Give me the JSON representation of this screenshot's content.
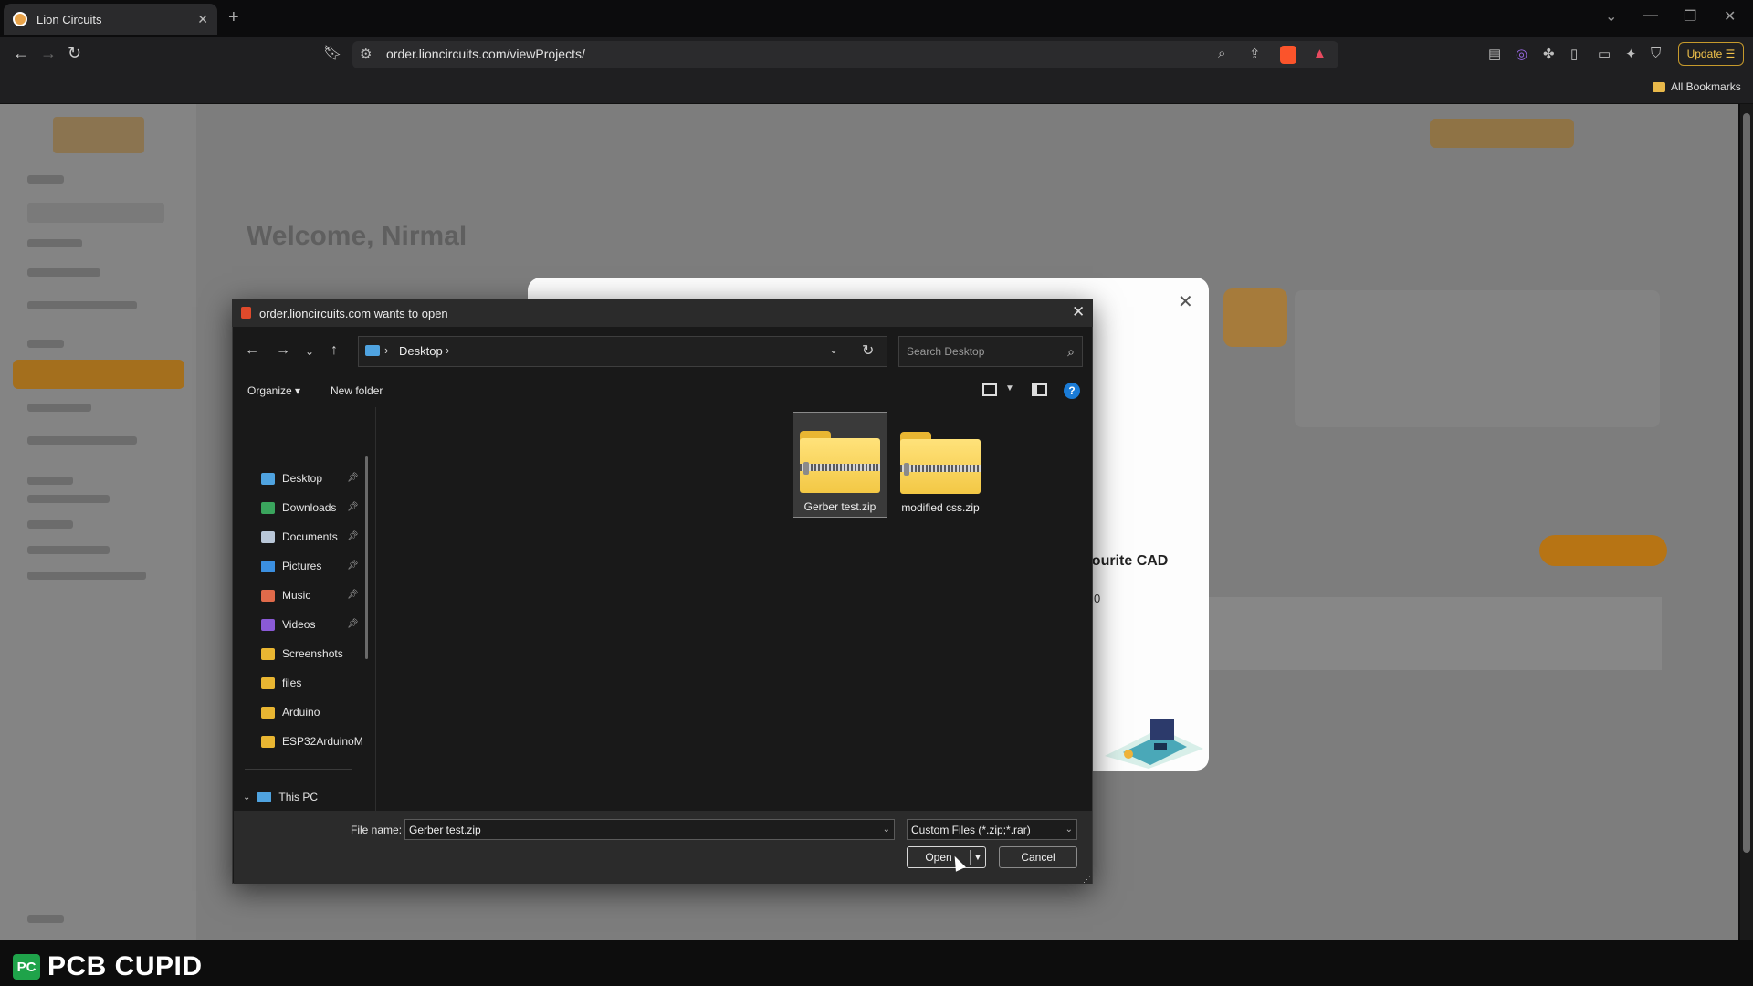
{
  "browser": {
    "tab_title": "Lion Circuits",
    "url": "order.lioncircuits.com/viewProjects/",
    "update_label": "Update",
    "bookmarks_label": "All Bookmarks"
  },
  "page": {
    "welcome": "Welcome, Nirmal",
    "modal_partial_text": "avourite CAD",
    "modal_partial_text2": "0"
  },
  "dialog": {
    "title": "order.lioncircuits.com wants to open",
    "address": {
      "segment": "Desktop"
    },
    "search_placeholder": "Search Desktop",
    "organize_label": "Organize",
    "new_folder_label": "New folder",
    "nav_items": [
      {
        "label": "Desktop",
        "icon": "desktop-icon",
        "pinned": true,
        "color": "#4fa3e0"
      },
      {
        "label": "Downloads",
        "icon": "download-icon",
        "pinned": true,
        "color": "#3aa55d"
      },
      {
        "label": "Documents",
        "icon": "document-icon",
        "pinned": true,
        "color": "#b9c7d8"
      },
      {
        "label": "Pictures",
        "icon": "pictures-icon",
        "pinned": true,
        "color": "#3b8fe0"
      },
      {
        "label": "Music",
        "icon": "music-icon",
        "pinned": true,
        "color": "#e06a4a"
      },
      {
        "label": "Videos",
        "icon": "videos-icon",
        "pinned": true,
        "color": "#8a5ad6"
      },
      {
        "label": "Screenshots",
        "icon": "folder-icon",
        "pinned": false,
        "color": "#e9b632"
      },
      {
        "label": "files",
        "icon": "folder-icon",
        "pinned": false,
        "color": "#e9b632"
      },
      {
        "label": "Arduino",
        "icon": "folder-icon",
        "pinned": false,
        "color": "#e9b632"
      },
      {
        "label": "ESP32ArduinoM",
        "icon": "folder-icon",
        "pinned": false,
        "color": "#e9b632"
      }
    ],
    "this_pc_label": "This PC",
    "files": [
      {
        "name": "Gerber test.zip",
        "selected": true,
        "icon": "zip-folder-icon"
      },
      {
        "name": "modified css.zip",
        "selected": false,
        "icon": "zip-folder-icon"
      }
    ],
    "file_name_label": "File name:",
    "file_name_value": "Gerber test.zip",
    "filter_value": "Custom Files (*.zip;*.rar)",
    "open_label": "Open",
    "cancel_label": "Cancel"
  },
  "watermark": {
    "badge": "PC",
    "text": "PCB CUPID"
  }
}
